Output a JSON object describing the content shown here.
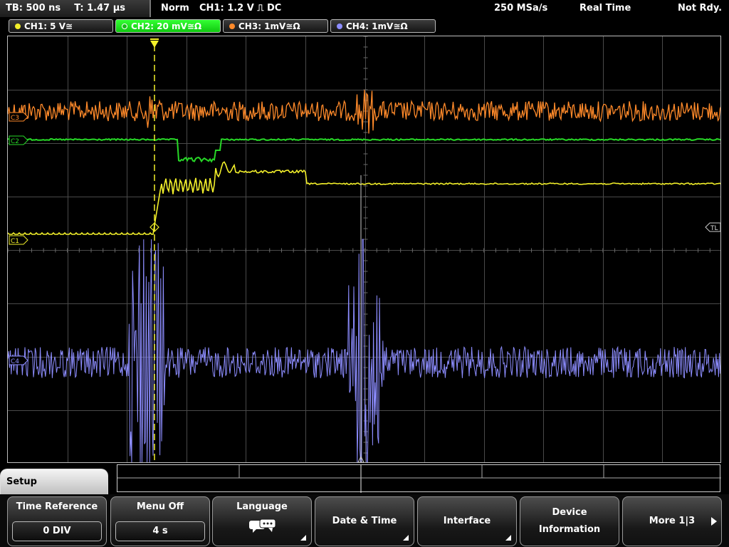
{
  "status_bar": {
    "timebase": "TB: 500 ns",
    "trigger_time": "T: 1.47 µs",
    "acq_mode": "Norm",
    "trigger_info": "CH1: 1.2 V ⎍ DC",
    "sample_rate": "250 MSa/s",
    "acq_type": "Real Time",
    "ready_state": "Not Rdy."
  },
  "channels": [
    {
      "label": "CH1: 5 V≅",
      "color": "#f2ef2a"
    },
    {
      "label": "CH2: 20 mV≅Ω",
      "color": "#27d827"
    },
    {
      "label": "CH3: 1mV≅Ω",
      "color": "#ff8a2a"
    },
    {
      "label": "CH4: 1mV≅Ω",
      "color": "#8d8dff"
    }
  ],
  "markers": {
    "ch1": "C1",
    "ch2": "C2",
    "ch3": "C3",
    "ch4": "C4",
    "trigger_level": "TL"
  },
  "menu": {
    "title": "Setup",
    "time_reference": {
      "label": "Time Reference",
      "value": "0 DIV"
    },
    "menu_off": {
      "label": "Menu Off",
      "value": "4 s"
    },
    "language": {
      "label": "Language",
      "icon": "speech-bubbles-icon"
    },
    "date_time": {
      "label": "Date & Time"
    },
    "interface": {
      "label": "Interface"
    },
    "device_info": {
      "line1": "Device",
      "line2": "Information"
    },
    "more": {
      "label": "More 1|3"
    }
  }
}
